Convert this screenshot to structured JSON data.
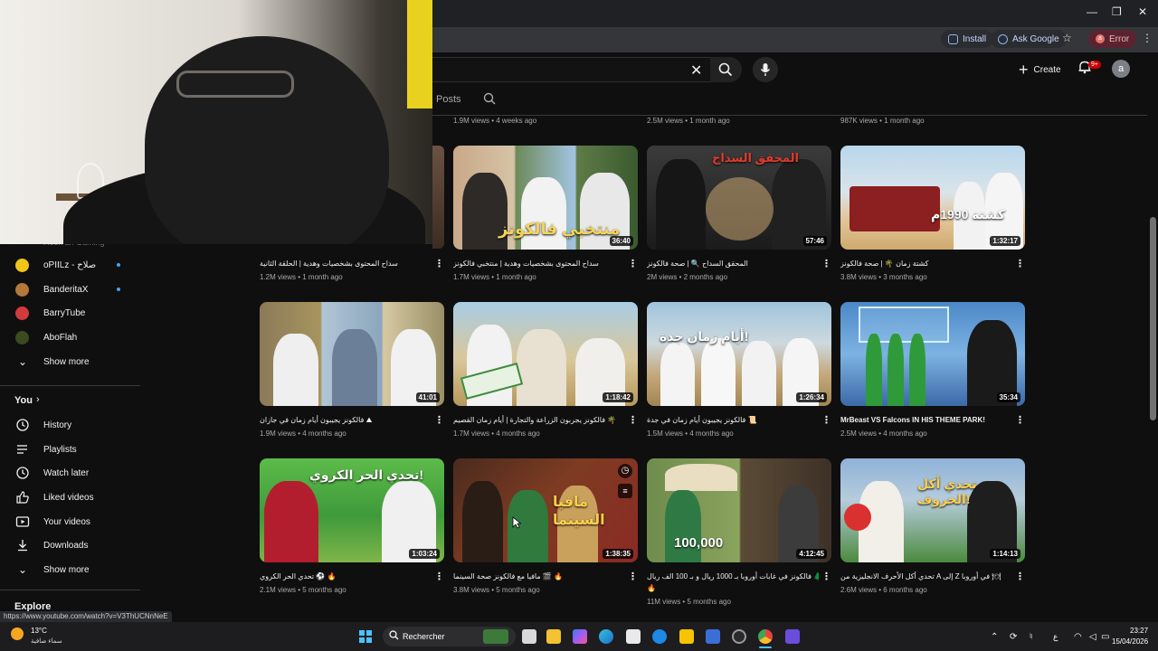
{
  "browser": {
    "install_label": "Install",
    "ask_label": "Ask Google",
    "error_label": "Error",
    "error_avatar": "a",
    "status_url": "https://www.youtube.com/watch?v=V3ThUCNnNeE"
  },
  "header": {
    "create_label": "Create",
    "notif_badge": "9+",
    "avatar_letter": "a"
  },
  "channel_tabs": {
    "posts_label": "Posts"
  },
  "sidebar": {
    "partial_text": "Hook an Gaming",
    "subscriptions": [
      {
        "label": "oPIILz - صلاح",
        "color": "#f0c419",
        "new": true
      },
      {
        "label": "BanderitaX",
        "color": "#b5773a",
        "new": true
      },
      {
        "label": "BarryTube",
        "color": "#d13b3b",
        "new": false
      },
      {
        "label": "AboFlah",
        "color": "#3b4a1f",
        "new": false
      }
    ],
    "show_more_1": "Show more",
    "you_label": "You",
    "you_items": [
      {
        "label": "History",
        "icon": "history-icon"
      },
      {
        "label": "Playlists",
        "icon": "playlists-icon"
      },
      {
        "label": "Watch later",
        "icon": "watch-later-icon"
      },
      {
        "label": "Liked videos",
        "icon": "liked-videos-icon"
      },
      {
        "label": "Your videos",
        "icon": "your-videos-icon"
      },
      {
        "label": "Downloads",
        "icon": "downloads-icon"
      }
    ],
    "show_more_2": "Show more",
    "explore_label": "Explore"
  },
  "top_meta": [
    "1.9M views • 4 weeks ago",
    "2.5M views • 1 month ago",
    "987K views • 1 month ago"
  ],
  "videos": [
    {
      "title": "سداح المحتوى بشخصيات وهدية | الحلقة الثانية",
      "meta": "1.2M views • 1 month ago",
      "duration": "",
      "overlay": ""
    },
    {
      "title": "سداح المحتوى بشخصيات وهدية | منتخبي فالكونز",
      "meta": "1.7M views • 1 month ago",
      "duration": "36:40",
      "overlay": "منتخبي فالكونز"
    },
    {
      "title": "المحقق السداح 🔍 | صحة فالكونز",
      "meta": "2M views • 2 months ago",
      "duration": "57:46",
      "overlay": "المحقق السداح"
    },
    {
      "title": "كشتة زمان 🌴 | صحة فالكونز",
      "meta": "3.8M views • 3 months ago",
      "duration": "1:32:17",
      "overlay": "كشتة 1990م"
    },
    {
      "title": "فالكونز يجيبون أيام زمان في جازان ⛰",
      "meta": "1.9M views • 4 months ago",
      "duration": "41:01",
      "overlay": ""
    },
    {
      "title": "فالكونز يجربون الزراعة والتجارة | أيام زمان القصيم 🌴",
      "meta": "1.7M views • 4 months ago",
      "duration": "1:18:42",
      "overlay": ""
    },
    {
      "title": "فالكونز يجيبون أيام زمان في جدة 📜",
      "meta": "1.5M views • 4 months ago",
      "duration": "1:26:34",
      "overlay": "أيام زمان جدة!"
    },
    {
      "title": "MrBeast VS Falcons IN HIS THEME PARK!",
      "meta": "2.5M views • 4 months ago",
      "duration": "35:34",
      "overlay": ""
    },
    {
      "title": "تحدي الحر الكروي ⚽ 🔥",
      "meta": "2.1M views • 5 months ago",
      "duration": "1:03:24",
      "overlay": "تحدي الحر الكروي!"
    },
    {
      "title": "مافيا مع فالكونز صحة السينما 🎬 🔥",
      "meta": "3.8M views • 5 months ago",
      "duration": "1:38:35",
      "overlay": "مافيا السينما"
    },
    {
      "title": "فالكونز في غابات أوروبا بـ 1000 ريال و بـ 100 الف ريال 🌲",
      "title2": "🔥",
      "meta": "11M views • 5 months ago",
      "duration": "4:12:45",
      "overlay": "100,000"
    },
    {
      "title": "تحدي أكل الأحرف الانجليزية من A إلى Z في أوروبا 🍽",
      "meta": "2.6M views • 6 months ago",
      "duration": "1:14:13",
      "overlay": "تحدي أكل الحروف!"
    }
  ],
  "taskbar": {
    "temp": "13°C",
    "condition": "سماء صافية",
    "search_placeholder": "Rechercher",
    "lang": "ع",
    "time": "23:27",
    "date": "15/04/2026"
  },
  "colors": {
    "accent_blue": "#3ea6ff",
    "notif_red": "#cc0000",
    "background": "#0f0f0f"
  }
}
